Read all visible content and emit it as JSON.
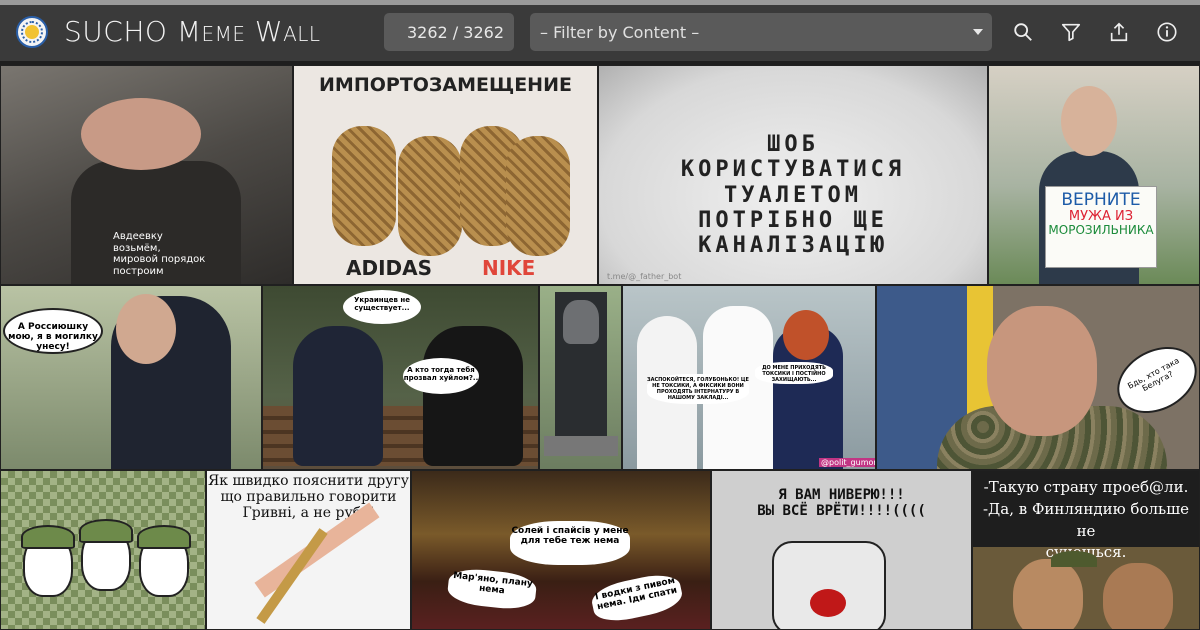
{
  "header": {
    "title_prefix": "SUCHO",
    "title_sc": "Meme Wall",
    "counter": "3262 / 3262",
    "filter_placeholder": "– Filter by Content –"
  },
  "memes": {
    "m1_caption": "Авдеевку\nвозьмём,\nмировой порядок\nпостроим",
    "m2_heading": "ИМПОРТОЗАМЕЩЕНИЕ",
    "m2_left": "ADIDAS",
    "m2_right": "NIKE",
    "m3_text": "ШОБ\nКОРИСТУВАТИСЯ\nТУАЛЕТОМ\nПОТРІБНО ЩЕ\nКАНАЛІЗАЦІЮ",
    "m3_watermark": "t.me/@_father_bot",
    "m4_sign1": "ВЕРНИТЕ",
    "m4_sign2": "МУЖА ИЗ",
    "m4_sign3": "МОРОЗИЛЬНИКА",
    "m5_bubble": "А Россиюшку мою,\nя в могилку унесу!",
    "m6_bubble1": "Украинцев не\nсуществует...",
    "m6_bubble2": "А кто тогда тебя\nпрозвал хуйлом?..",
    "m8_bubble1": "ЗАСПОКОЙТЕСЯ, ГОЛУБОНЬКО!\nЦЕ НЕ ТОКСИКИ, А ФІКСИКИ\nВОНИ ПРОХОДЯТЬ ІНТЕРНАТУРУ\nВ НАШОМУ ЗАКЛАДІ...",
    "m8_bubble2": "ДО МЕНЕ ПРИХОДЯТЬ ТОКСИКИ\nІ ПОСТІЙНО ЗАХИЩАЮТЬ...",
    "m8_tag": "@polit_gumor",
    "m9_bubble": "Бдь,\nхто така Белуга?",
    "m11_caption": "Як швидко пояснити другу\nщо правильно говорити\nГривні, а не рублі",
    "m12_bubble1": "Солей і спайсів у\nмене для тебе теж\nнема",
    "m12_bubble2": "Мар'яно, плану\nнема",
    "m12_bubble3": "І водки з пивом\nнема. Іди спати",
    "m13_caption": "Я ВАМ НИВЕРЮ!!!\nВЫ ВСЁ ВРЁТИ!!!!((((",
    "m14_caption": "-Такую страну проеб@ли.\n-Да, в Финляндию больше не\nсунешься."
  },
  "colors": {
    "header_bg": "#3a3a3a",
    "control_bg": "#5a5a5a",
    "logo_blue": "#2a5fa8",
    "logo_yellow": "#f1c232"
  },
  "icons": [
    "search-icon",
    "filter-icon",
    "share-icon",
    "info-icon"
  ]
}
